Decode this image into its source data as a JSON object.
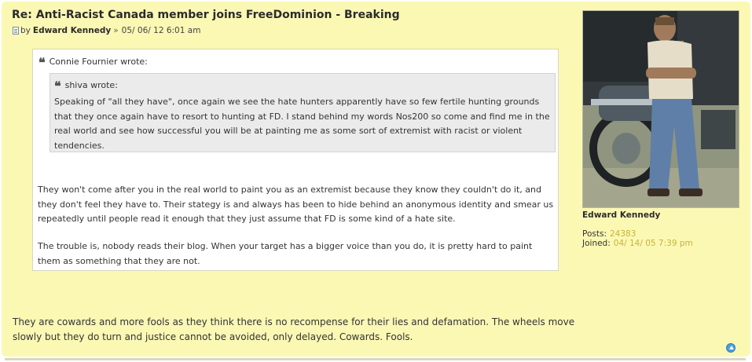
{
  "post": {
    "title": "Re: Anti-Racist Canada member joins FreeDominion - Breaking",
    "by_label": "by",
    "author": "Edward Kennedy",
    "separator": "»",
    "date": "05/ 06/ 12 6:01 am",
    "outer_quote": {
      "cite": "Connie Fournier wrote:",
      "inner_quote": {
        "cite": "shiva wrote:",
        "text": "Speaking of \"all they have\", once again we see the hate hunters apparently have so few fertile hunting grounds that they once again have to resort to hunting at FD. I stand behind my words Nos200 so come and find me in the real world and see how successful you will be at painting me as some sort of extremist with racist or violent tendencies."
      },
      "paragraph_1": "They won't come after you in the real world to paint you as an extremist because they know they couldn't do it, and they don't feel they have to. Their stategy is and always has been to hide behind an anonymous identity and smear us repeatedly until people read it enough that they just assume that FD is some kind of a hate site.",
      "paragraph_2": "The trouble is, nobody reads their blog. When your target has a bigger voice than you do, it is pretty hard to paint them as something that they are not."
    },
    "body": "They are cowards and more fools as they think there is no recompense for their lies and defamation. The wheels move slowly but they do turn and justice cannot be avoided, only delayed. Cowards. Fools."
  },
  "profile": {
    "username": "Edward Kennedy",
    "posts_label": "Posts:",
    "posts_value": "24383",
    "joined_label": "Joined:",
    "joined_value": "04/ 14/ 05 7:39 pm"
  },
  "icons": {
    "post_icon": "post-icon",
    "quote_mark": "quote-icon",
    "top_button": "back-to-top-icon"
  },
  "colors": {
    "post_background": "#fbf8b4",
    "profile_value": "#c7b23a",
    "top_button": "#4a9fe0"
  }
}
